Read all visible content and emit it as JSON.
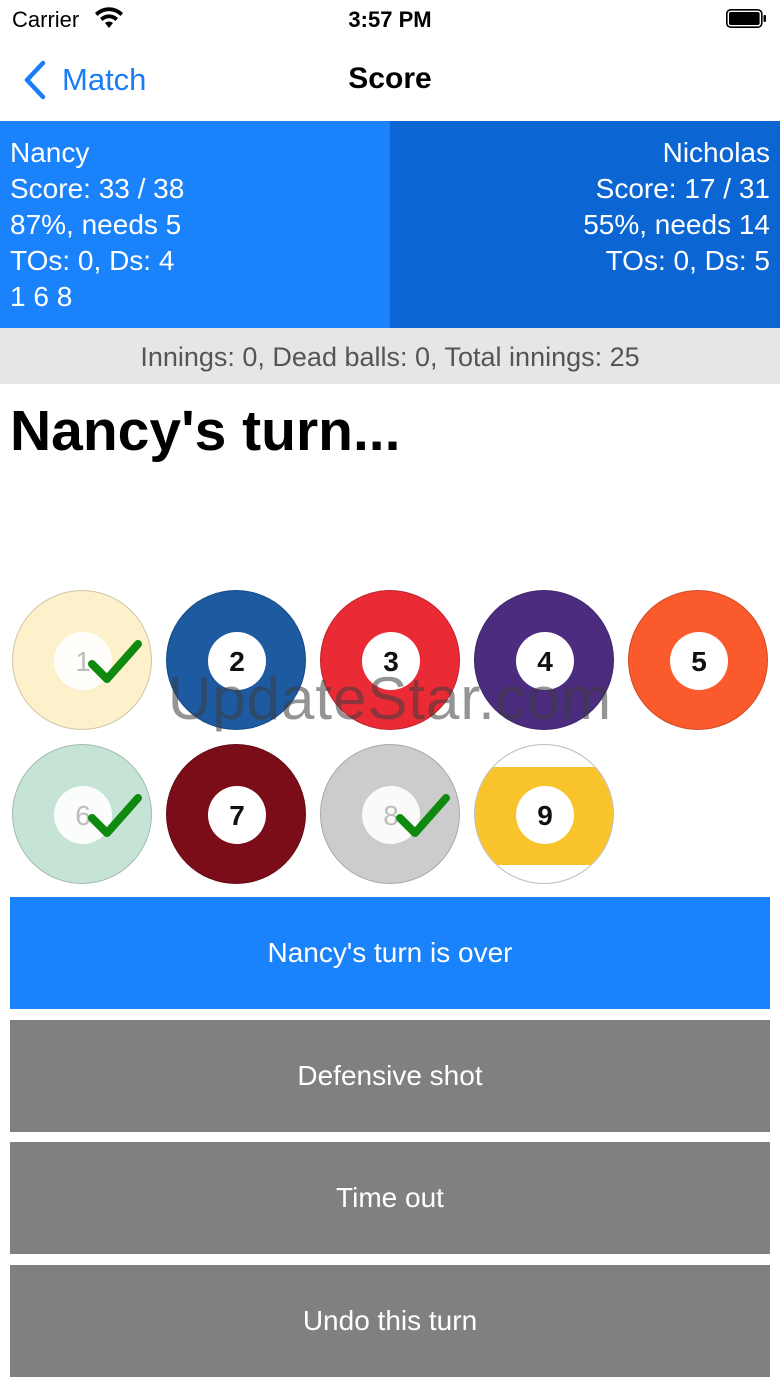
{
  "status_bar": {
    "carrier": "Carrier",
    "time": "3:57 PM"
  },
  "nav": {
    "back_label": "Match",
    "title": "Score"
  },
  "players": {
    "left": {
      "name": "Nancy",
      "score": "Score: 33 / 38",
      "pct": "87%, needs 5",
      "tos": "TOs: 0, Ds: 4",
      "balls": "1 6 8"
    },
    "right": {
      "name": "Nicholas",
      "score": "Score: 17 / 31",
      "pct": "55%, needs 14",
      "tos": "TOs: 0, Ds: 5"
    }
  },
  "innings": "Innings: 0, Dead balls: 0, Total innings: 25",
  "turn_title": "Nancy's turn...",
  "watermark": "UpdateStar.com",
  "balls": [
    {
      "number": "1",
      "color": "#fdf1cc",
      "pocketed": true
    },
    {
      "number": "2",
      "color": "#1d5aa0",
      "pocketed": false
    },
    {
      "number": "3",
      "color": "#ea2a35",
      "pocketed": false
    },
    {
      "number": "4",
      "color": "#4b2c7e",
      "pocketed": false
    },
    {
      "number": "5",
      "color": "#fb5b2c",
      "pocketed": false
    },
    {
      "number": "6",
      "color": "#c6e4d6",
      "pocketed": true
    },
    {
      "number": "7",
      "color": "#7b0d18",
      "pocketed": false
    },
    {
      "number": "8",
      "color": "#cccccc",
      "pocketed": true
    },
    {
      "number": "9",
      "color": "#f8c32b",
      "pocketed": false,
      "striped": true
    }
  ],
  "buttons": {
    "turn_over": "Nancy's turn is over",
    "defensive": "Defensive shot",
    "timeout": "Time out",
    "undo": "Undo this turn"
  },
  "colors": {
    "accent": "#1a82fb",
    "accent_dark": "#0b66d4",
    "button_grey": "#808080",
    "check": "#0f8a0f"
  },
  "icons": {
    "back": "chevron-left-icon",
    "check": "checkmark-icon",
    "wifi": "wifi-icon",
    "battery": "battery-icon"
  }
}
